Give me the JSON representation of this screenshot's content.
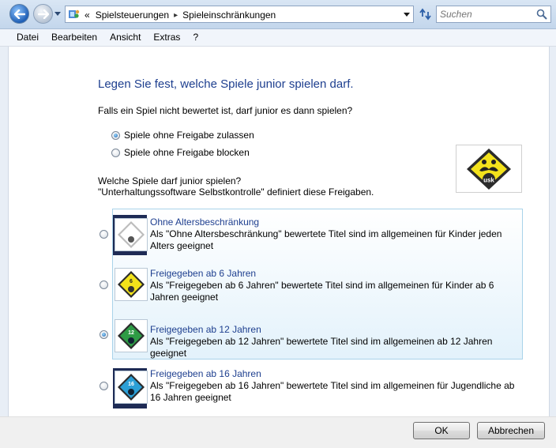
{
  "address_bar": {
    "prefix": "«",
    "breadcrumbs": [
      "Spielsteuerungen",
      "Spieleinschränkungen"
    ],
    "separator": "▸"
  },
  "search": {
    "placeholder": "Suchen"
  },
  "menu": [
    "Datei",
    "Bearbeiten",
    "Ansicht",
    "Extras",
    "?"
  ],
  "main": {
    "heading": "Legen Sie fest, welche Spiele junior spielen darf.",
    "unrated_question": "Falls ein Spiel nicht bewertet ist, darf junior es dann spielen?",
    "unrated_options": [
      {
        "label": "Spiele ohne Freigabe zulassen",
        "selected": true
      },
      {
        "label": "Spiele ohne Freigabe blocken",
        "selected": false
      }
    ],
    "rating_question": "Welche Spiele darf junior spielen?",
    "rating_note": "\"Unterhaltungssoftware Selbstkontrolle\" definiert diese Freigaben.",
    "logo_text": "usk",
    "ratings": [
      {
        "title": "Ohne Altersbeschränkung",
        "desc": "Als \"Ohne Altersbeschränkung\" bewertete Titel sind im allgemeinen für Kinder jeden Alters geeignet",
        "age": "",
        "color": "#ffffff",
        "selected": false
      },
      {
        "title": "Freigegeben ab 6 Jahren",
        "desc": "Als \"Freigegeben ab 6 Jahren\" bewertete Titel sind im allgemeinen für Kinder ab 6 Jahren geeignet",
        "age": "6",
        "color": "#f2e21a",
        "selected": false
      },
      {
        "title": "Freigegeben ab 12 Jahren",
        "desc": "Als \"Freigegeben ab 12 Jahren\" bewertete Titel sind im allgemeinen ab 12 Jahren geeignet",
        "age": "12",
        "color": "#2e9b45",
        "selected": true
      },
      {
        "title": "Freigegeben ab 16 Jahren",
        "desc": "Als \"Freigegeben ab 16 Jahren\" bewertete Titel sind im allgemeinen für Jugendliche ab 16 Jahren geeignet",
        "age": "16",
        "color": "#2b9fd6",
        "selected": false
      }
    ]
  },
  "buttons": {
    "ok": "OK",
    "cancel": "Abbrechen"
  },
  "icons": [
    "back-arrow-icon",
    "forward-arrow-icon",
    "parental-controls-icon",
    "refresh-icon",
    "search-icon",
    "usk-logo-icon"
  ]
}
